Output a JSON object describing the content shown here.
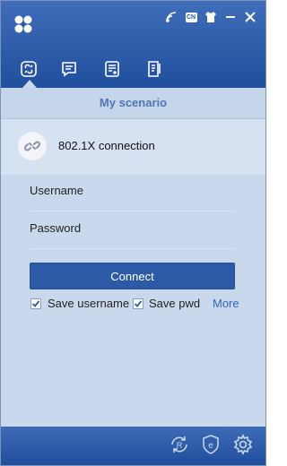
{
  "app": {
    "accent": "#2c5aa7",
    "logo": "four-petal-logo"
  },
  "titlebar": {
    "icons": [
      "wifi-signal-icon",
      "language-cn-icon",
      "shirt-skin-icon",
      "minimize-icon",
      "close-icon"
    ],
    "language_badge": "CN"
  },
  "tabs": [
    {
      "name": "link-scenario-icon",
      "selected": true
    },
    {
      "name": "message-icon",
      "selected": false
    },
    {
      "name": "list-document-icon",
      "selected": false
    },
    {
      "name": "notebook-edit-icon",
      "selected": false
    }
  ],
  "scenario": {
    "title": "My scenario"
  },
  "connection": {
    "label": "802.1X connection",
    "icon": "broken-link-icon"
  },
  "form": {
    "username_label": "Username",
    "password_label": "Password",
    "connect_label": "Connect",
    "save_username_label": "Save username",
    "save_username_checked": true,
    "save_pwd_label": "Save pwd",
    "save_pwd_checked": true,
    "more_label": "More"
  },
  "footer": {
    "icons": [
      "registered-refresh-icon",
      "e-shield-icon",
      "gear-icon"
    ]
  }
}
